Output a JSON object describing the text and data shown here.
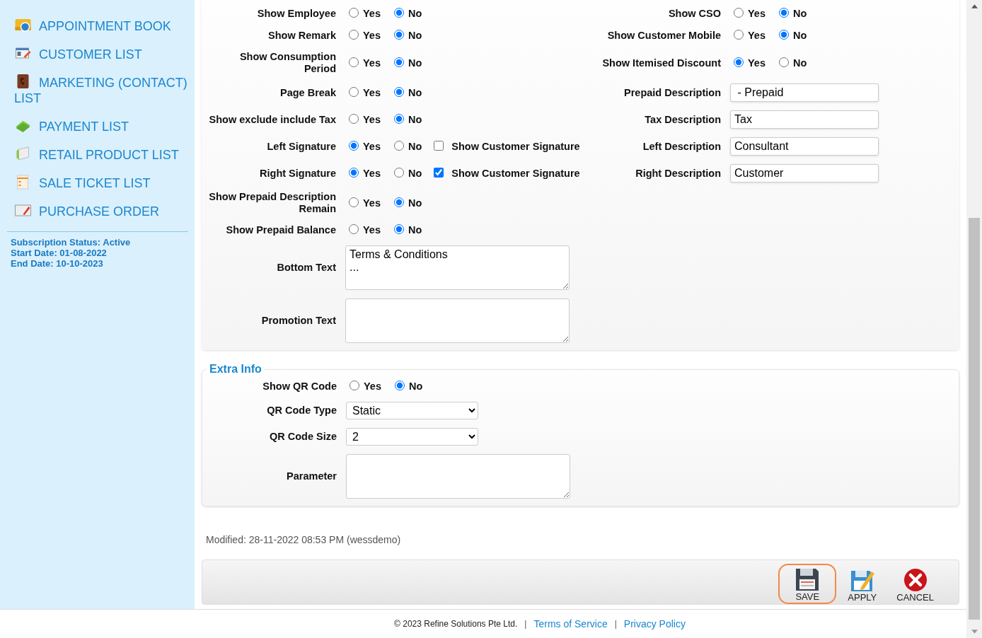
{
  "sidebar": {
    "items": [
      {
        "label": "APPOINTMENT BOOK"
      },
      {
        "label": "CUSTOMER LIST"
      },
      {
        "label": "MARKETING (CONTACT) LIST"
      },
      {
        "label": "PAYMENT LIST"
      },
      {
        "label": "RETAIL PRODUCT LIST"
      },
      {
        "label": "SALE TICKET LIST"
      },
      {
        "label": "PURCHASE ORDER"
      }
    ],
    "subscription": [
      "Subscription Status: Active",
      "Start Date: 01-08-2022",
      "End Date: 10-10-2023"
    ]
  },
  "form_rows": [
    {
      "left": {
        "kind": "radio",
        "label": "Show Employee",
        "options": [
          {
            "label": "Yes",
            "selected": false
          },
          {
            "label": "No",
            "selected": true
          }
        ]
      },
      "right": {
        "kind": "radio",
        "label": "Show CSO",
        "options": [
          {
            "label": "Yes",
            "selected": false
          },
          {
            "label": "No",
            "selected": true
          }
        ]
      }
    },
    {
      "left": {
        "kind": "radio",
        "label": "Show Remark",
        "options": [
          {
            "label": "Yes",
            "selected": false
          },
          {
            "label": "No",
            "selected": true
          }
        ]
      },
      "right": {
        "kind": "radio",
        "label": "Show Customer Mobile",
        "options": [
          {
            "label": "Yes",
            "selected": false
          },
          {
            "label": "No",
            "selected": true
          }
        ]
      }
    },
    {
      "left": {
        "kind": "radio",
        "label": "Show Consumption Period",
        "options": [
          {
            "label": "Yes",
            "selected": false
          },
          {
            "label": "No",
            "selected": true
          }
        ]
      },
      "right": {
        "kind": "radio",
        "label": "Show Itemised Discount",
        "options": [
          {
            "label": "Yes",
            "selected": true
          },
          {
            "label": "No",
            "selected": false
          }
        ]
      }
    },
    {
      "left": {
        "kind": "radio",
        "label": "Page Break",
        "options": [
          {
            "label": "Yes",
            "selected": false
          },
          {
            "label": "No",
            "selected": true
          }
        ]
      },
      "right": {
        "kind": "text",
        "label": "Prepaid Description",
        "value": " - Prepaid"
      }
    },
    {
      "left": {
        "kind": "radio",
        "label": "Show exclude include Tax",
        "options": [
          {
            "label": "Yes",
            "selected": false
          },
          {
            "label": "No",
            "selected": true
          }
        ]
      },
      "right": {
        "kind": "text",
        "label": "Tax Description",
        "value": "Tax"
      }
    },
    {
      "left": {
        "kind": "radio",
        "label": "Left Signature",
        "options": [
          {
            "label": "Yes",
            "selected": true
          },
          {
            "label": "No",
            "selected": false
          }
        ],
        "checkbox": {
          "label": "Show Customer Signature",
          "checked": false
        }
      },
      "right": {
        "kind": "text",
        "label": "Left Description",
        "value": "Consultant"
      }
    },
    {
      "left": {
        "kind": "radio",
        "label": "Right Signature",
        "options": [
          {
            "label": "Yes",
            "selected": true
          },
          {
            "label": "No",
            "selected": false
          }
        ],
        "checkbox": {
          "label": "Show Customer Signature",
          "checked": true
        }
      },
      "right": {
        "kind": "text",
        "label": "Right Description",
        "value": "Customer"
      }
    },
    {
      "left": {
        "kind": "radio",
        "label": "Show Prepaid Description Remain",
        "options": [
          {
            "label": "Yes",
            "selected": false
          },
          {
            "label": "No",
            "selected": true
          }
        ]
      }
    },
    {
      "left": {
        "kind": "radio",
        "label": "Show Prepaid Balance",
        "options": [
          {
            "label": "Yes",
            "selected": false
          },
          {
            "label": "No",
            "selected": true
          }
        ]
      }
    },
    {
      "left": {
        "kind": "textarea",
        "label": "Bottom Text",
        "value": "Terms & Conditions\n..."
      }
    },
    {
      "left": {
        "kind": "textarea",
        "label": "Promotion Text"
      }
    }
  ],
  "extra_info": {
    "legend": "Extra Info",
    "fields": [
      {
        "kind": "radio",
        "label": "Show QR Code",
        "options": [
          {
            "label": "Yes",
            "selected": false
          },
          {
            "label": "No",
            "selected": true
          }
        ]
      },
      {
        "kind": "select",
        "label": "QR Code Type",
        "value": "Static"
      },
      {
        "kind": "select",
        "label": "QR Code Size",
        "value": "2"
      },
      {
        "kind": "textarea",
        "label": "Parameter"
      }
    ]
  },
  "modified": "Modified: 28-11-2022 08:53 PM (wessdemo)",
  "buttons": [
    {
      "kind": "save",
      "label": "SAVE",
      "focused": true
    },
    {
      "kind": "apply",
      "label": "APPLY",
      "focused": false
    },
    {
      "kind": "cancel",
      "label": "CANCEL",
      "focused": false
    }
  ],
  "footer": [
    {
      "kind": "text",
      "text": "© 2023 Refine Solutions Pte Ltd."
    },
    {
      "kind": "sep",
      "text": "|"
    },
    {
      "kind": "link",
      "text": "Terms of Service"
    },
    {
      "kind": "sep",
      "text": "|"
    },
    {
      "kind": "link",
      "text": "Privacy Policy"
    }
  ]
}
